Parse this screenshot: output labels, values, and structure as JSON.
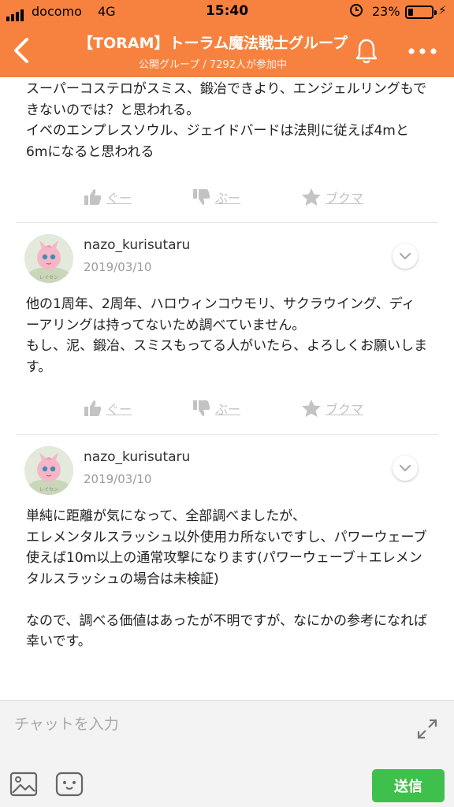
{
  "status_bar": {
    "carrier": "docomo",
    "network": "4G",
    "time": "15:40",
    "battery_percent": "23%",
    "battery_level": 0.23
  },
  "header": {
    "title": "【TORAM】トーラム魔法戦士グループ",
    "subtitle": "公開グループ / 7292人が参加中",
    "back_icon": "chevron-left-icon",
    "notification_icon": "bell-icon",
    "more_icon": "more-dots-icon"
  },
  "reaction_labels": {
    "like": "ぐー",
    "dislike": "ぶー",
    "bookmark": "ブクマ"
  },
  "messages": [
    {
      "text": "スーパーコステロがスミス、鍛冶できより、エンジェルリングもできないのでは？と思われる。\nイベのエンプレスソウル、ジェイドバードは法則に従えば4mと6mになると思われる"
    },
    {
      "username": "nazo_kurisutaru",
      "date": "2019/03/10",
      "avatar_caption": "レイセン",
      "text": "他の1周年、2周年、ハロウィンコウモリ、サクラウイング、ディーアリングは持ってないため調べていません。\nもし、泥、鍛冶、スミスもってる人がいたら、よろしくお願いします。"
    },
    {
      "username": "nazo_kurisutaru",
      "date": "2019/03/10",
      "avatar_caption": "レイセン",
      "text": "単純に距離が気になって、全部調べましたが、\nエレメンタルスラッシュ以外使用カ所ないですし、パワーウェーブ使えば10m以上の通常攻撃になります(パワーウェーブ＋エレメンタルスラッシュの場合は未検証)\n\nなので、調べる価値はあったが不明ですが、なにかの参考になれば幸いです。"
    }
  ],
  "input": {
    "placeholder": "チャットを入力",
    "send_label": "送信"
  },
  "colors": {
    "header": "#f7823f",
    "send_button": "#3fbf4c",
    "reaction": "#c3c3c3"
  }
}
